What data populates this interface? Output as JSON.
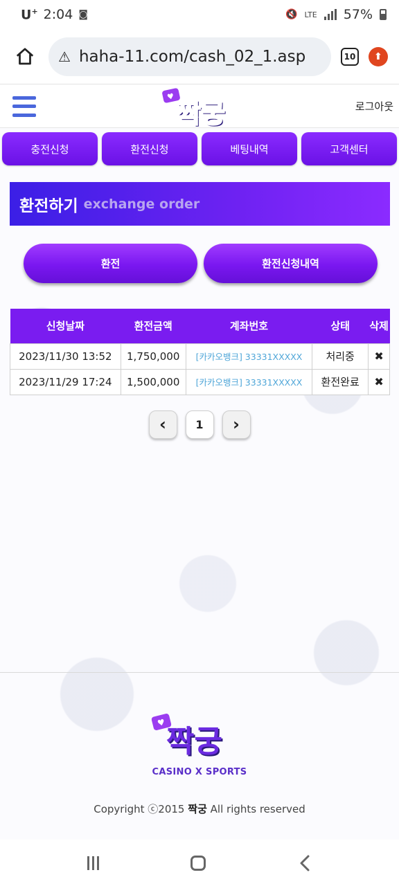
{
  "status_bar": {
    "carrier": "U",
    "carrier_sup": "+",
    "time": "2:04",
    "network": "LTE",
    "battery": "57%"
  },
  "browser": {
    "url": "haha-11.com/cash_02_1.asp",
    "tab_count": "10"
  },
  "header": {
    "logo_text": "짝궁",
    "logout_label": "로그아웃"
  },
  "nav": [
    {
      "label": "충전신청"
    },
    {
      "label": "환전신청"
    },
    {
      "label": "베팅내역"
    },
    {
      "label": "고객센터"
    }
  ],
  "title": {
    "main": "환전하기",
    "sub": "exchange order"
  },
  "actions": {
    "exchange_label": "환전",
    "history_label": "환전신청내역"
  },
  "table": {
    "headers": [
      "신청날짜",
      "환전금액",
      "계좌번호",
      "상태",
      "삭제"
    ],
    "rows": [
      {
        "date": "2023/11/30 13:52",
        "amount": "1,750,000",
        "account": "[카카오뱅크] 33331XXXXX",
        "status": "처리중",
        "delete": "✖"
      },
      {
        "date": "2023/11/29 17:24",
        "amount": "1,500,000",
        "account": "[카카오뱅크] 33331XXXXX",
        "status": "환전완료",
        "delete": "✖"
      }
    ]
  },
  "pagination": {
    "prev": "‹",
    "current": "1",
    "next": "›"
  },
  "footer": {
    "logo_text": "짝궁",
    "tagline": "CASINO X SPORTS",
    "copyright_prefix": "Copyright ⓒ2015",
    "copyright_brand": "짝궁",
    "copyright_suffix": "All rights reserved"
  },
  "colors": {
    "primary_purple": "#7a1cf0",
    "title_gradient_start": "#3b1fe6",
    "account_link": "#4fa6d8",
    "hamburger": "#4a67dc"
  }
}
